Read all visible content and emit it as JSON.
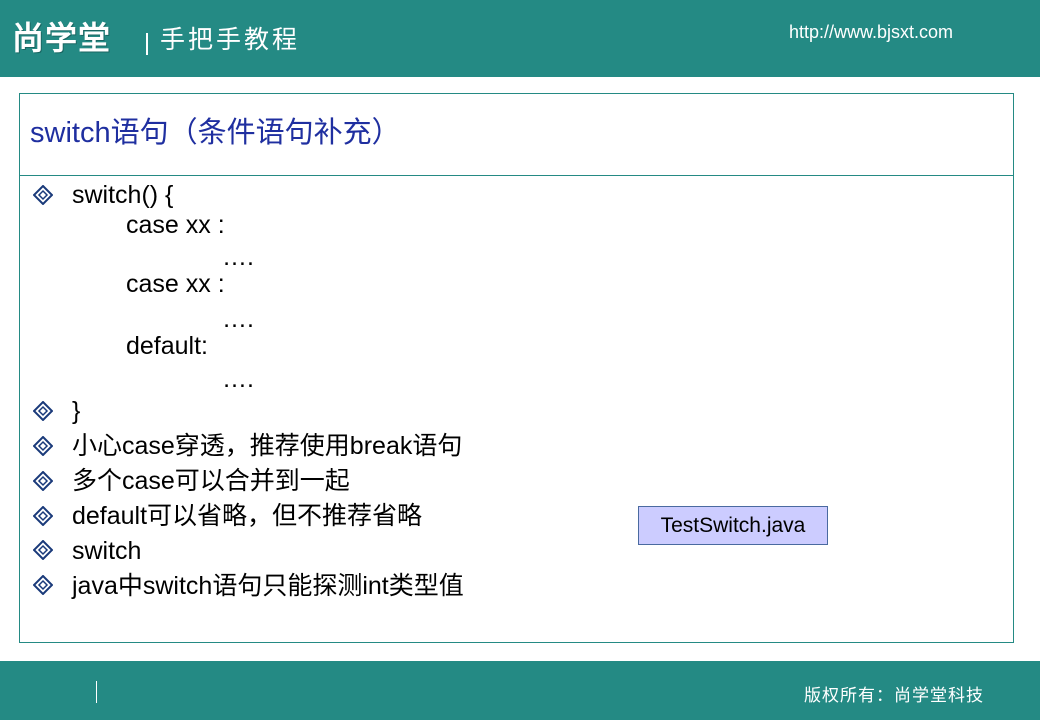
{
  "header": {
    "logo_text": "尚学堂",
    "tagline": "手把手教程",
    "url": "http://www.bjsxt.com"
  },
  "slide": {
    "title": "switch语句（条件语句补充）",
    "code_lines": [
      "switch() {",
      "case xx :",
      "….",
      "case xx :",
      "….",
      "default:",
      "…."
    ],
    "bullets": [
      "}",
      "小心case穿透，推荐使用break语句",
      "多个case可以合并到一起",
      "default可以省略，但不推荐省略",
      "switch",
      "java中switch语句只能探测int类型值"
    ],
    "file_label": "TestSwitch.java"
  },
  "footer": {
    "copyright": "版权所有：尚学堂科技"
  },
  "colors": {
    "band": "#248a84",
    "title": "#1f2fa0",
    "file_box_bg": "#ccccff"
  }
}
